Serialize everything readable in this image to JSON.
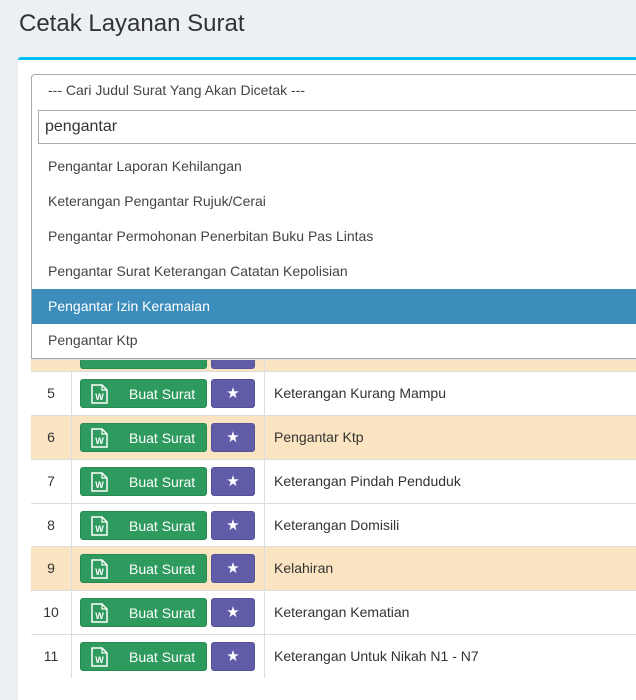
{
  "page": {
    "title": "Cetak Layanan Surat"
  },
  "select": {
    "placeholder": "--- Cari Judul Surat Yang Akan Dicetak ---",
    "search_value": "pengantar",
    "options": [
      "Pengantar Laporan Kehilangan",
      "Keterangan Pengantar Rujuk/Cerai",
      "Pengantar Permohonan Penerbitan Buku Pas Lintas",
      "Pengantar Surat Keterangan Catatan Kepolisian",
      "Pengantar Izin Keramaian",
      "Pengantar Ktp"
    ],
    "highlighted_index": 4
  },
  "table": {
    "make_label": "Buat Surat",
    "rows": [
      {
        "num": "5",
        "title": "Keterangan Kurang Mampu"
      },
      {
        "num": "6",
        "title": "Pengantar Ktp"
      },
      {
        "num": "7",
        "title": "Keterangan Pindah Penduduk"
      },
      {
        "num": "8",
        "title": "Keterangan Domisili"
      },
      {
        "num": "9",
        "title": "Kelahiran"
      },
      {
        "num": "10",
        "title": "Keterangan Kematian"
      },
      {
        "num": "11",
        "title": "Keterangan Untuk Nikah N1 - N7"
      }
    ]
  },
  "colors": {
    "accent": "#00c0ef",
    "highlight": "#3c8dbc",
    "success": "#2e9a5e",
    "purple": "#605ca8",
    "row_alt": "#fbe4c1"
  },
  "icons": {
    "word": "word-doc-icon",
    "star": "star-icon"
  }
}
